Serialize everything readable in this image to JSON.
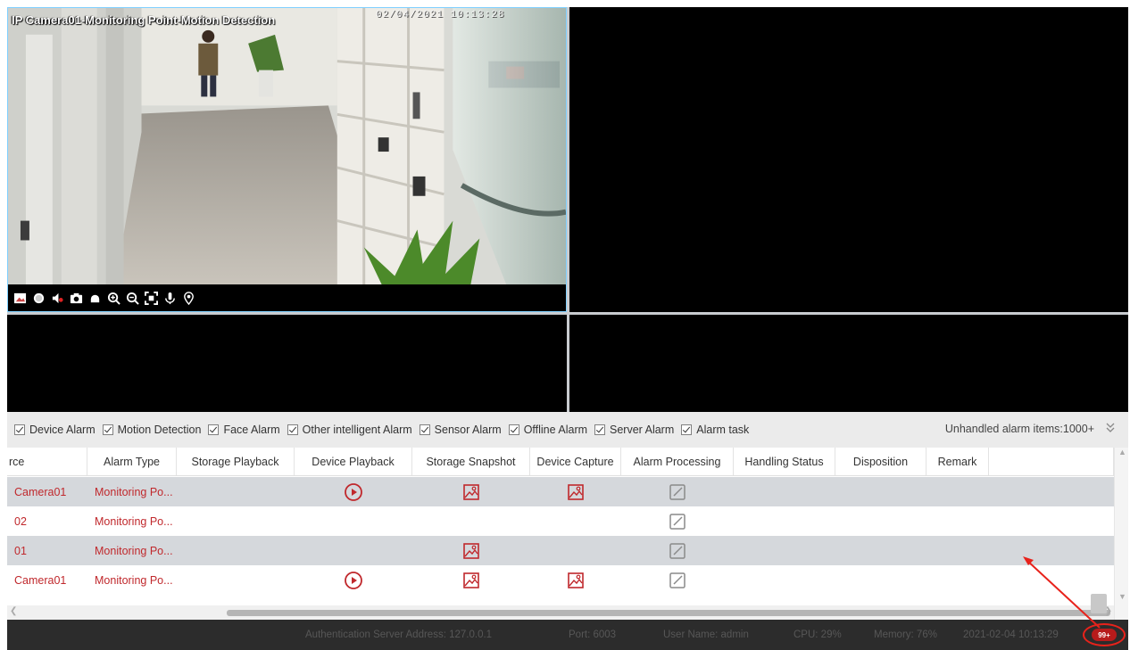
{
  "camera": {
    "title": "IP Camera01-Monitoring Point-Motion Detection",
    "timestamp": "02/04/2021 10:13:28",
    "toolbar_icons": [
      "snapshot-frame-icon",
      "record-icon",
      "audio-mute-icon",
      "camera-snapshot-icon",
      "ptz-icon",
      "zoom-in-icon",
      "zoom-out-icon",
      "fit-screen-icon",
      "microphone-icon",
      "location-icon"
    ]
  },
  "filters": {
    "items": [
      {
        "label": "Device Alarm",
        "checked": true
      },
      {
        "label": "Motion Detection",
        "checked": true
      },
      {
        "label": "Face Alarm",
        "checked": true
      },
      {
        "label": "Other intelligent Alarm",
        "checked": true
      },
      {
        "label": "Sensor Alarm",
        "checked": true
      },
      {
        "label": "Offline Alarm",
        "checked": true
      },
      {
        "label": "Server Alarm",
        "checked": true
      },
      {
        "label": "Alarm task",
        "checked": true
      }
    ],
    "unhandled_label": "Unhandled alarm items:1000+"
  },
  "table": {
    "headers": [
      "rce",
      "Alarm Type",
      "Storage Playback",
      "Device Playback",
      "Storage Snapshot",
      "Device Capture",
      "Alarm Processing",
      "Handling Status",
      "Disposition",
      "Remark",
      ""
    ],
    "rows": [
      {
        "source": "Camera01",
        "alarm_type": "Monitoring Po...",
        "device_playback": true,
        "storage_snapshot": true,
        "device_capture": true,
        "processing": true
      },
      {
        "source": "02",
        "alarm_type": "Monitoring Po...",
        "device_playback": false,
        "storage_snapshot": false,
        "device_capture": false,
        "processing": true
      },
      {
        "source": "01",
        "alarm_type": "Monitoring Po...",
        "device_playback": false,
        "storage_snapshot": true,
        "device_capture": false,
        "processing": true
      },
      {
        "source": "Camera01",
        "alarm_type": "Monitoring Po...",
        "device_playback": true,
        "storage_snapshot": true,
        "device_capture": true,
        "processing": true
      }
    ]
  },
  "status_bar": {
    "auth_server": "Authentication Server  Address: 127.0.0.1",
    "port": "Port: 6003",
    "user": "User Name: admin",
    "cpu": "CPU: 29%",
    "memory": "Memory: 76%",
    "datetime": "2021-02-04 10:13:29",
    "alarm_badge": "99+"
  },
  "colors": {
    "alarm_red": "#c0282c",
    "row_highlight": "#d5d8dc",
    "status_bg": "#2c2c2c",
    "badge_red": "#b71b1b"
  }
}
